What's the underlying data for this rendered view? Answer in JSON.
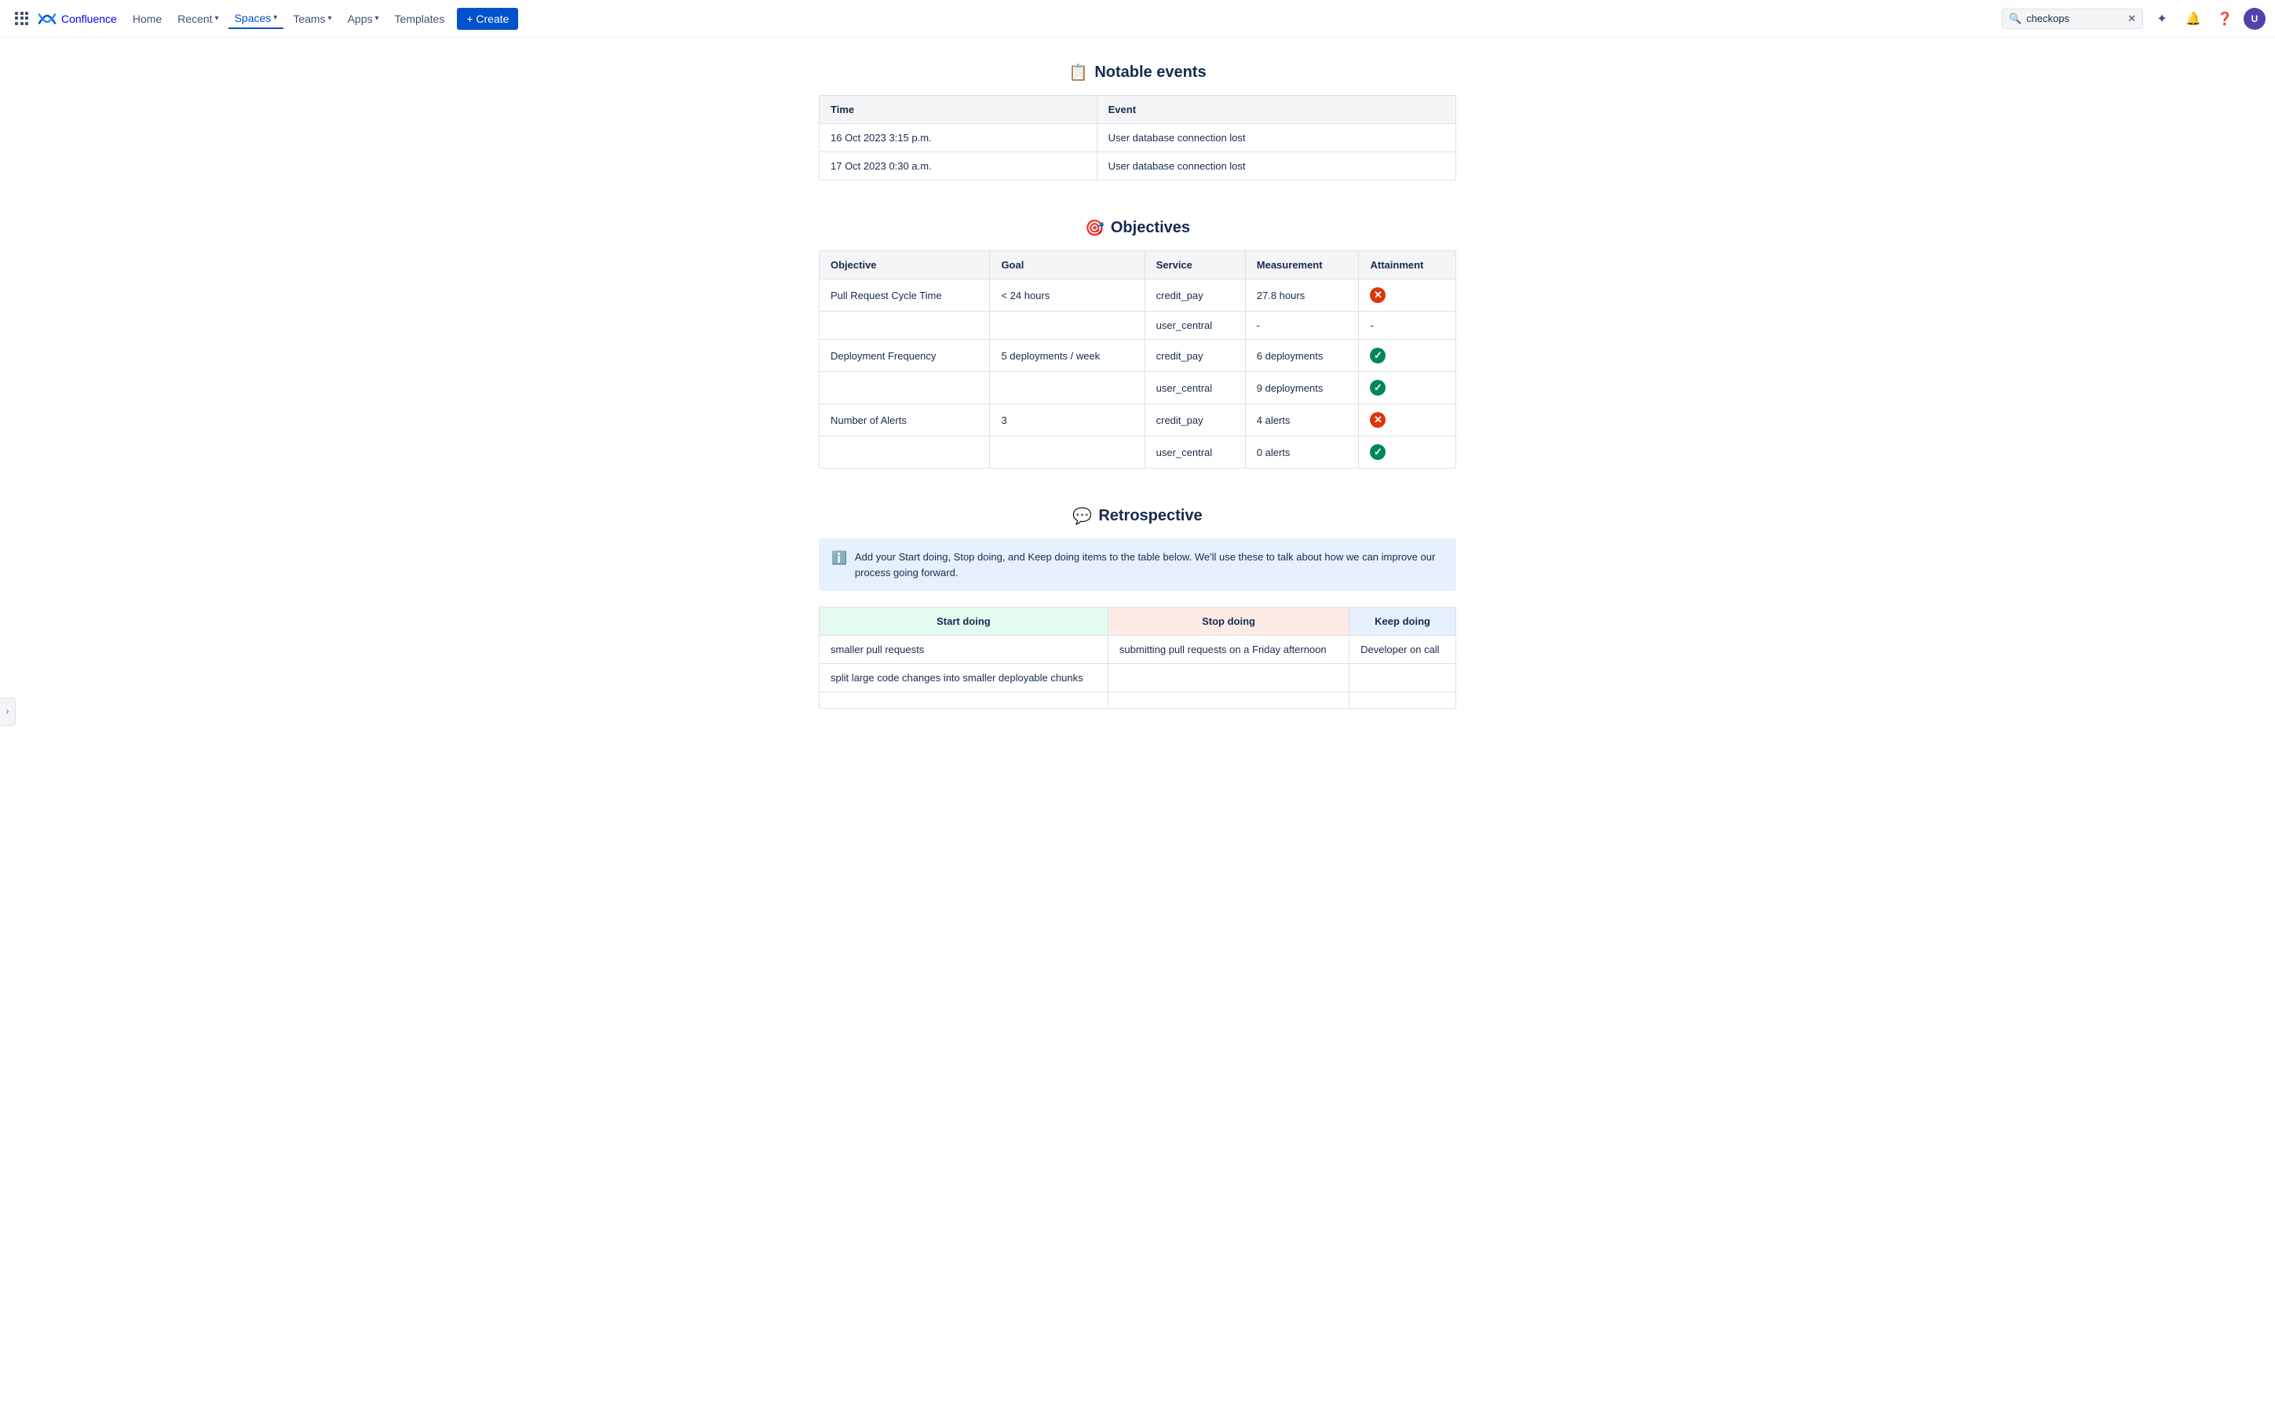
{
  "nav": {
    "logo_text": "Confluence",
    "home": "Home",
    "recent": "Recent",
    "spaces": "Spaces",
    "teams": "Teams",
    "apps": "Apps",
    "templates": "Templates",
    "create": "+ Create",
    "search_value": "checkops",
    "avatar_initials": "U"
  },
  "notable_events": {
    "title": "Notable events",
    "icon": "📋",
    "headers": [
      "Time",
      "Event"
    ],
    "rows": [
      {
        "time": "16 Oct 2023  3:15 p.m.",
        "event": "User database connection lost"
      },
      {
        "time": "17 Oct 2023  0:30 a.m.",
        "event": "User database connection lost"
      }
    ]
  },
  "objectives": {
    "title": "Objectives",
    "icon": "🎯",
    "headers": [
      "Objective",
      "Goal",
      "Service",
      "Measurement",
      "Attainment"
    ],
    "rows": [
      {
        "objective": "Pull Request Cycle Time",
        "goal": "< 24 hours",
        "service": "credit_pay",
        "measurement": "27.8 hours",
        "attainment": "fail"
      },
      {
        "objective": "",
        "goal": "",
        "service": "user_central",
        "measurement": "-",
        "attainment": "dash"
      },
      {
        "objective": "Deployment Frequency",
        "goal": "5 deployments / week",
        "service": "credit_pay",
        "measurement": "6 deployments",
        "attainment": "pass"
      },
      {
        "objective": "",
        "goal": "",
        "service": "user_central",
        "measurement": "9 deployments",
        "attainment": "pass"
      },
      {
        "objective": "Number of Alerts",
        "goal": "3",
        "service": "credit_pay",
        "measurement": "4 alerts",
        "attainment": "fail"
      },
      {
        "objective": "",
        "goal": "",
        "service": "user_central",
        "measurement": "0 alerts",
        "attainment": "pass"
      }
    ]
  },
  "retrospective": {
    "title": "Retrospective",
    "icon": "💬",
    "info_text": "Add your Start doing, Stop doing, and Keep doing items to the table below. We'll use these to talk about how we can improve our process going forward.",
    "headers": {
      "start": "Start doing",
      "stop": "Stop doing",
      "keep": "Keep doing"
    },
    "rows": [
      {
        "start": "smaller pull requests",
        "stop": "submitting pull requests on a Friday afternoon",
        "keep": "Developer on call"
      },
      {
        "start": "split large code changes into smaller deployable chunks",
        "stop": "",
        "keep": ""
      },
      {
        "start": "",
        "stop": "",
        "keep": ""
      }
    ]
  }
}
